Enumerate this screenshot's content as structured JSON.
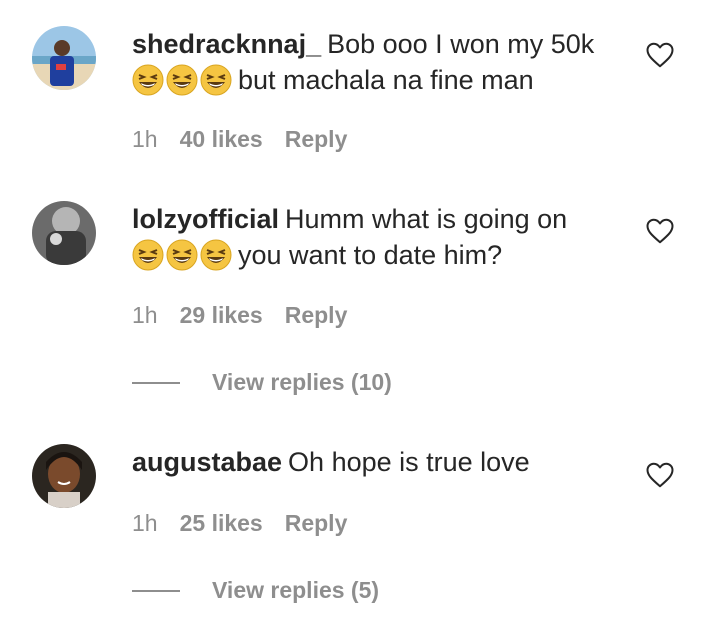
{
  "colors": {
    "text": "#262626",
    "muted": "#8e8e8e",
    "emoji": "#f5c542"
  },
  "icons": {
    "heart": "heart-outline-icon",
    "emoji": "grinning-squinting-face-emoji"
  },
  "comments": [
    {
      "username": "shedracknnaj_",
      "text_line1": "Bob ooo I won my 50k",
      "emoji_count": 3,
      "text_line2": "but machala na fine man",
      "time": "1h",
      "likes": "40 likes",
      "reply": "Reply"
    },
    {
      "username": "lolzyofficial",
      "text_line1": "Humm what is going on",
      "emoji_count": 3,
      "text_line2": "you want to date him?",
      "time": "1h",
      "likes": "29 likes",
      "reply": "Reply",
      "view_replies": "View replies (10)"
    },
    {
      "username": "augustabae",
      "text_line1": "Oh hope is true love",
      "time": "1h",
      "likes": "25 likes",
      "reply": "Reply",
      "view_replies": "View replies (5)"
    }
  ]
}
